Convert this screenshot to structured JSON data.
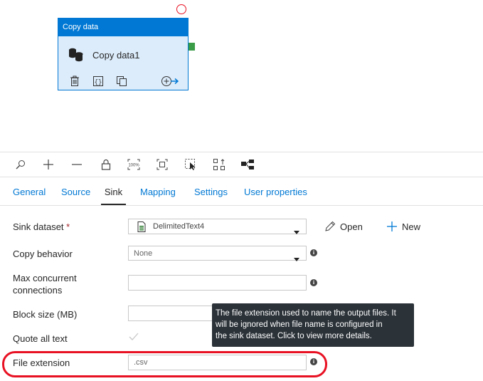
{
  "activity": {
    "header": "Copy data",
    "name": "Copy data1",
    "tools": [
      "delete-icon",
      "code-icon",
      "copy-icon",
      "add-output-icon"
    ]
  },
  "toolbar": {
    "icons": [
      "search-icon",
      "zoom-in-icon",
      "zoom-out-icon",
      "lock-icon",
      "zoom-100-icon",
      "fit-to-window-icon",
      "select-icon",
      "auto-align-icon",
      "layout-icon"
    ]
  },
  "tabs": [
    "General",
    "Source",
    "Sink",
    "Mapping",
    "Settings",
    "User properties"
  ],
  "active_tab": "Sink",
  "form": {
    "sink_dataset_label": "Sink dataset",
    "sink_dataset_required": "*",
    "sink_dataset_value": "DelimitedText4",
    "open_label": "Open",
    "new_label": "New",
    "copy_behavior_label": "Copy behavior",
    "copy_behavior_value": "None",
    "max_concurrent_label_1": "Max concurrent",
    "max_concurrent_label_2": "connections",
    "max_concurrent_value": "",
    "block_size_label": "Block size (MB)",
    "block_size_value": "",
    "quote_all_text_label": "Quote all text",
    "quote_all_text_checked": true,
    "file_extension_label": "File extension",
    "file_extension_value": ".csv"
  },
  "tooltip": {
    "line1": "The file extension used to name the output files. It",
    "line2": "will be ignored when file name is configured in",
    "line3": "the sink dataset. Click to view more details."
  },
  "colors": {
    "accent": "#0078d4",
    "card_bg": "#dcecfb",
    "highlight": "#e81123",
    "port": "#3a9c46",
    "tooltip_bg": "#2b3238"
  }
}
